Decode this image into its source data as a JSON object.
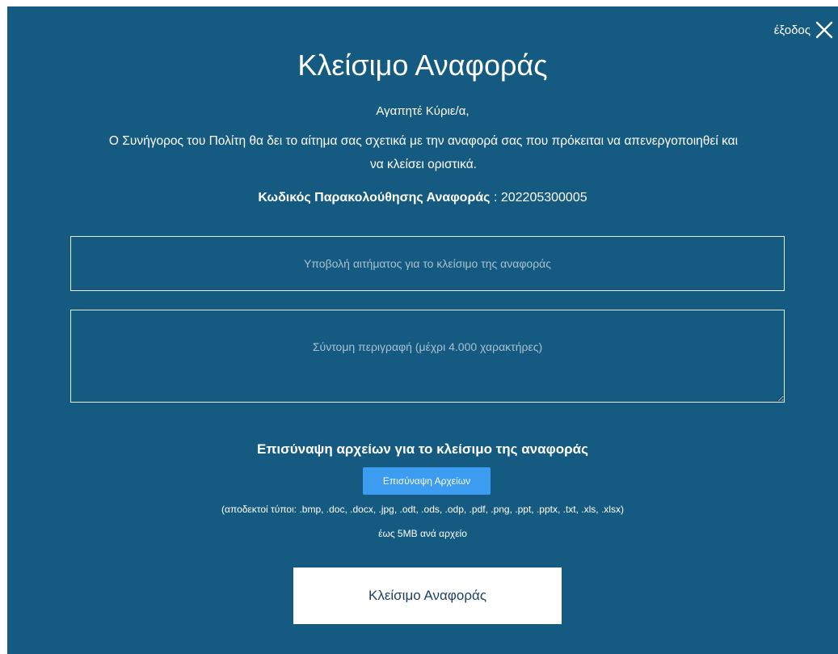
{
  "modal": {
    "close_label": "έξοδος",
    "close_icon": "close-x-icon",
    "title": "Κλείσιμο Αναφοράς",
    "greeting": "Αγαπητέ Κύριε/α,",
    "message": "Ο Συνήγορος του Πολίτη θα δει το αίτημα σας σχετικά με την αναφορά σας που πρόκειται να απενεργοποιηθεί και να κλείσει οριστικά.",
    "tracking_code_label": "Κωδικός Παρακολούθησης Αναφοράς",
    "tracking_code_value": ": 202205300005",
    "subject_placeholder": "Υποβολή αιτήματος για το κλείσιμο της αναφοράς",
    "description_placeholder": "Σύντομη περιγραφή (μέχρι 4.000 χαρακτήρες)",
    "attachments_heading": "Επισύναψη αρχείων για το κλείσιμο της αναφοράς",
    "attach_button_label": "Επισύναψη Αρχείων",
    "accepted_types": "(αποδεκτοί τύποι: .bmp, .doc, .docx, .jpg, .odt, .ods, .odp, .pdf, .png, .ppt, .pptx, .txt, .xls, .xlsx)",
    "size_limit": "έως 5MB ανά αρχείο",
    "submit_label": "Κλείσιμο Αναφοράς"
  },
  "colors": {
    "background": "#155a80",
    "attach_button": "#3c9cf0",
    "submit_button_bg": "#ffffff",
    "submit_button_text": "#1b3f5c"
  }
}
